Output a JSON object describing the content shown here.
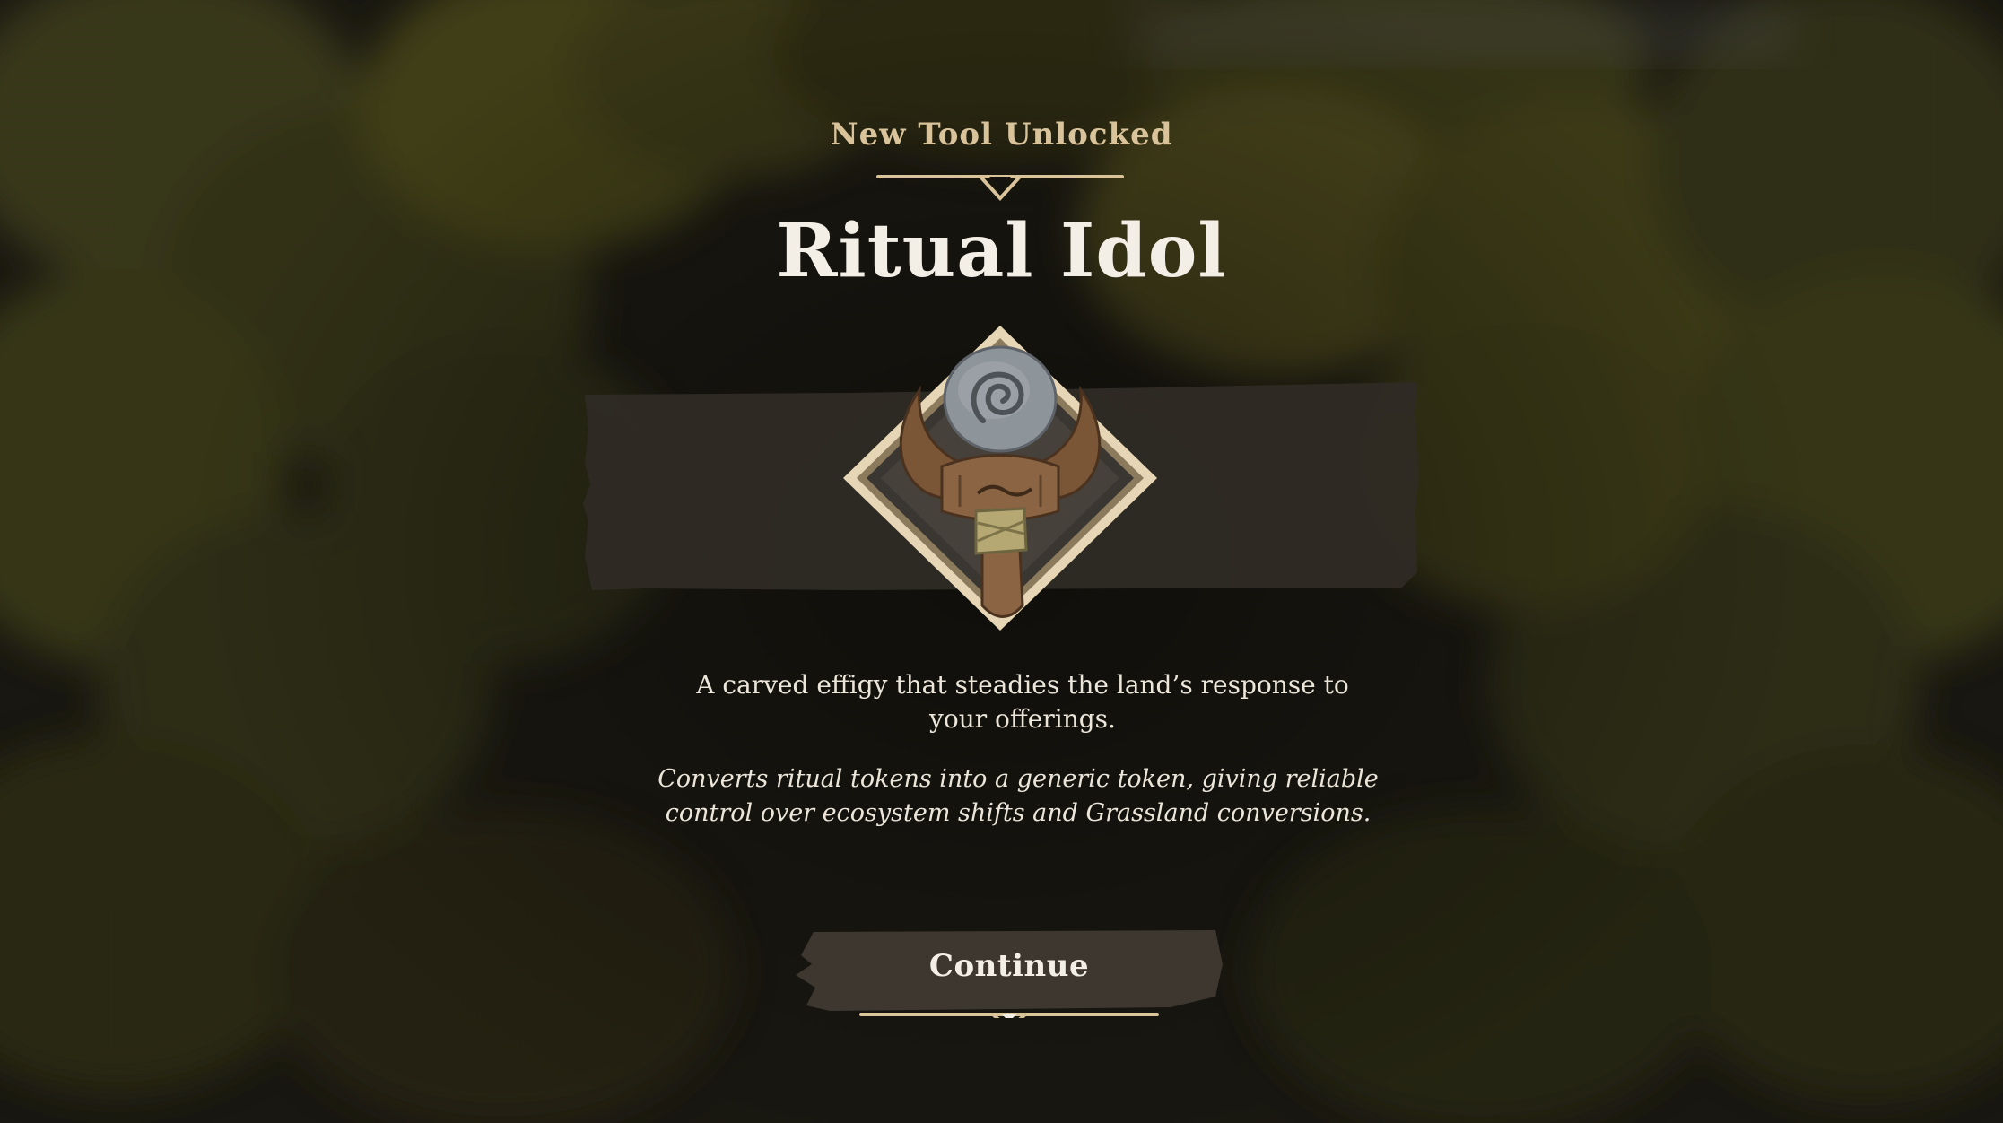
{
  "popup": {
    "eyebrow": "New Tool Unlocked",
    "title": "Ritual Idol",
    "description": "A carved effigy that steadies the land’s response to your offerings.",
    "effect": "Converts ritual tokens into a generic token, giving reliable control over ecosystem shifts and Grassland conversions.",
    "continue_label": "Continue"
  },
  "icons": {
    "item": "ritual-idol-icon",
    "divider": "ornament-divider-icon"
  },
  "colors": {
    "accent_gold": "#d9c39b",
    "title_text": "#f4efe6",
    "banner_fill": "#2f2b25",
    "button_fill": "#3d3730",
    "frame_cream": "#e6d6b6"
  }
}
